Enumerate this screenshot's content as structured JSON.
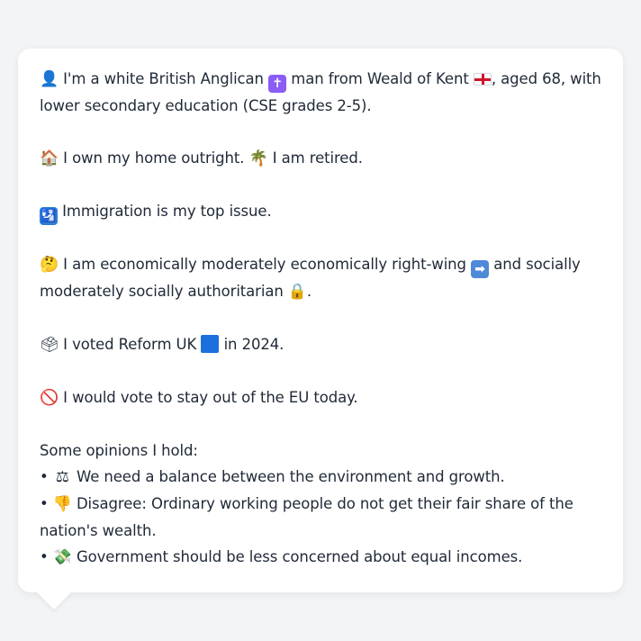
{
  "profile": {
    "line1_a": "I'm a white British Anglican",
    "line1_b": "man from Weald of Kent",
    "line1_c": ", aged 68, with",
    "line1_d": "lower secondary education (CSE grades 2-5).",
    "home_a": "I own my home outright.",
    "home_b": "I am retired.",
    "issue": "Immigration is my top issue.",
    "ideology_a": "I am economically moderately economically right-wing",
    "ideology_b": "and socially",
    "ideology_c": "moderately socially authoritarian",
    "ideology_d": ".",
    "vote_a": "I voted Reform UK",
    "vote_b": "in 2024.",
    "eu": "I would vote to stay out of the EU today.",
    "opinions_header": "Some opinions I hold:",
    "opinion1": "We need a balance between the environment and growth.",
    "opinion2_a": "Disagree: Ordinary working people do not get their fair share of the",
    "opinion2_b": "nation's wealth.",
    "opinion3": "Government should be less concerned about equal incomes."
  },
  "icons": {
    "person": "bust-in-silhouette-icon",
    "cross": "latin-cross-icon",
    "flag": "england-flag-icon",
    "house": "house-icon",
    "palm": "palm-tree-icon",
    "immigration": "passport-control-icon",
    "thinking": "thinking-face-icon",
    "arrow": "right-arrow-icon",
    "lock": "lock-icon",
    "ballot": "ballot-box-icon",
    "party_square": "blue-square-icon",
    "no_entry": "prohibited-icon",
    "scales": "balance-scale-icon",
    "thumbs_down": "thumbs-down-icon",
    "money": "money-icon"
  },
  "colors": {
    "background": "#f3f4f6",
    "bubble": "#ffffff",
    "text": "#1f2937"
  }
}
